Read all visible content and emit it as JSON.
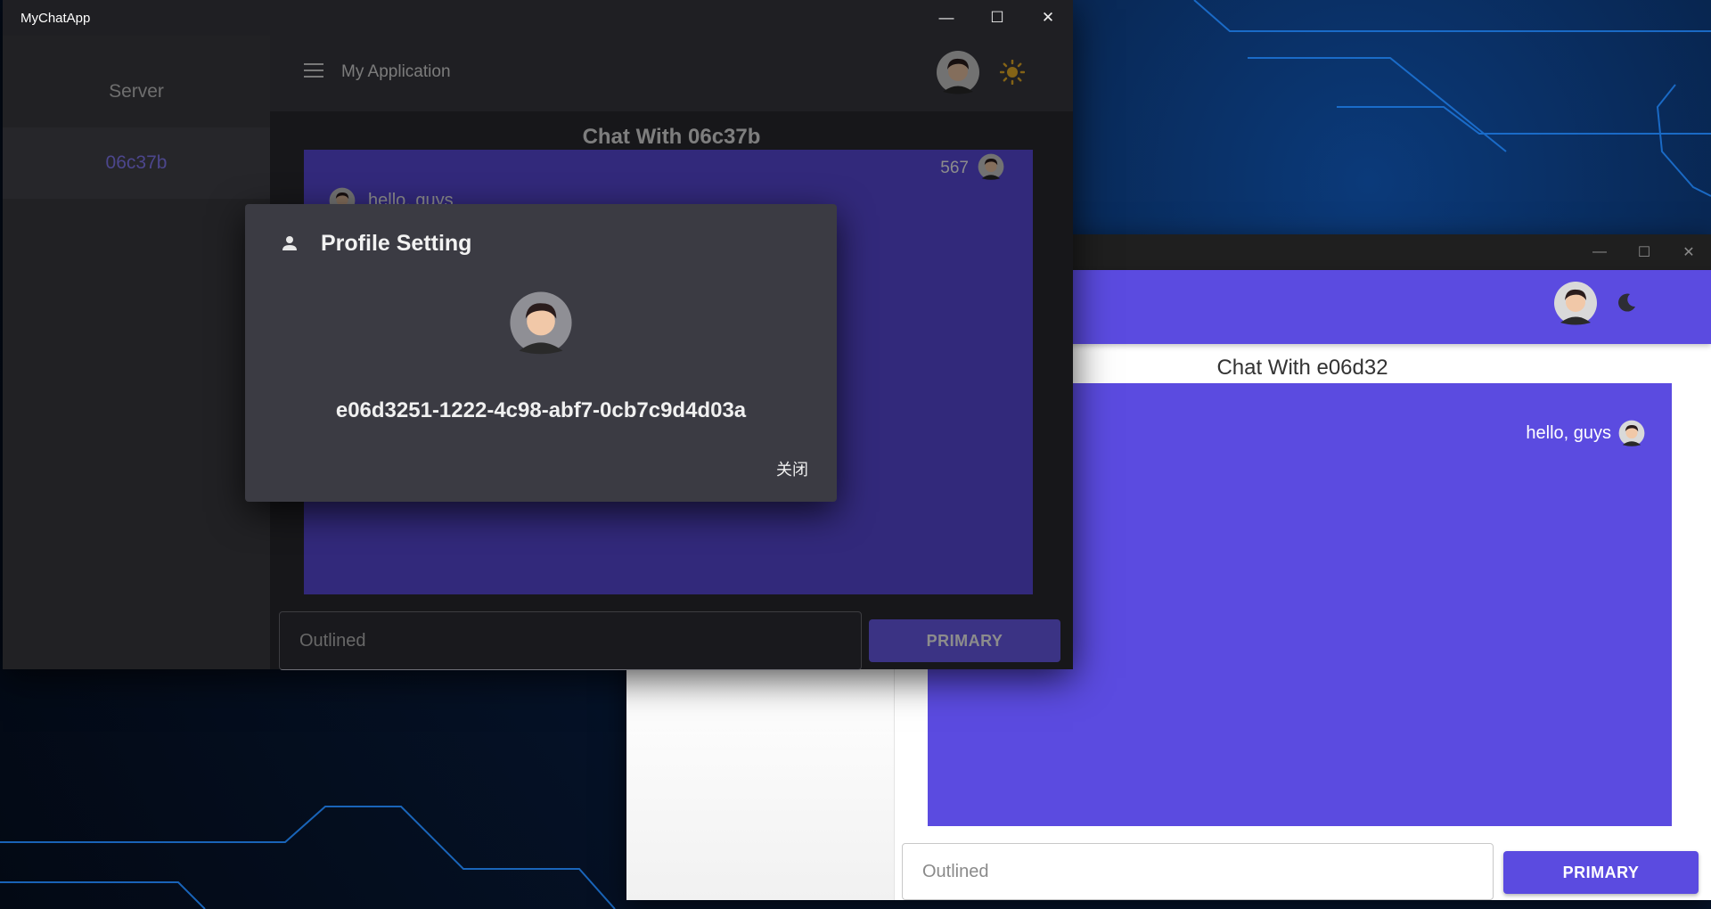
{
  "front_window": {
    "title": "MyChatApp",
    "controls": {
      "minimize": "—",
      "maximize": "☐",
      "close": "✕"
    },
    "sidebar": {
      "items": [
        {
          "label": "Server"
        },
        {
          "label": "06c37b"
        }
      ]
    },
    "appbar": {
      "app_name": "My Application",
      "theme_icon": "sun-icon"
    },
    "chat": {
      "title": "Chat With 06c37b",
      "count": "567",
      "messages": [
        {
          "text": "hello, guys"
        }
      ]
    },
    "input": {
      "placeholder": "Outlined"
    },
    "primary_button": "PRIMARY"
  },
  "dialog": {
    "title": "Profile Setting",
    "icon": "person-icon",
    "user_id": "e06d3251-1222-4c98-abf7-0cb7c9d4d03a",
    "close_label": "关闭"
  },
  "back_window": {
    "controls": {
      "minimize": "—",
      "maximize": "☐",
      "close": "✕"
    },
    "appbar": {
      "theme_icon": "moon-icon"
    },
    "chat": {
      "title": "Chat With e06d32",
      "messages": [
        {
          "text": "hello, guys"
        }
      ]
    },
    "input": {
      "placeholder": "Outlined"
    },
    "primary_button": "PRIMARY"
  },
  "colors": {
    "accent": "#5b4be0",
    "dark_surface": "#2b2b31",
    "dialog": "#3b3b43",
    "sun": "#f0b429"
  }
}
